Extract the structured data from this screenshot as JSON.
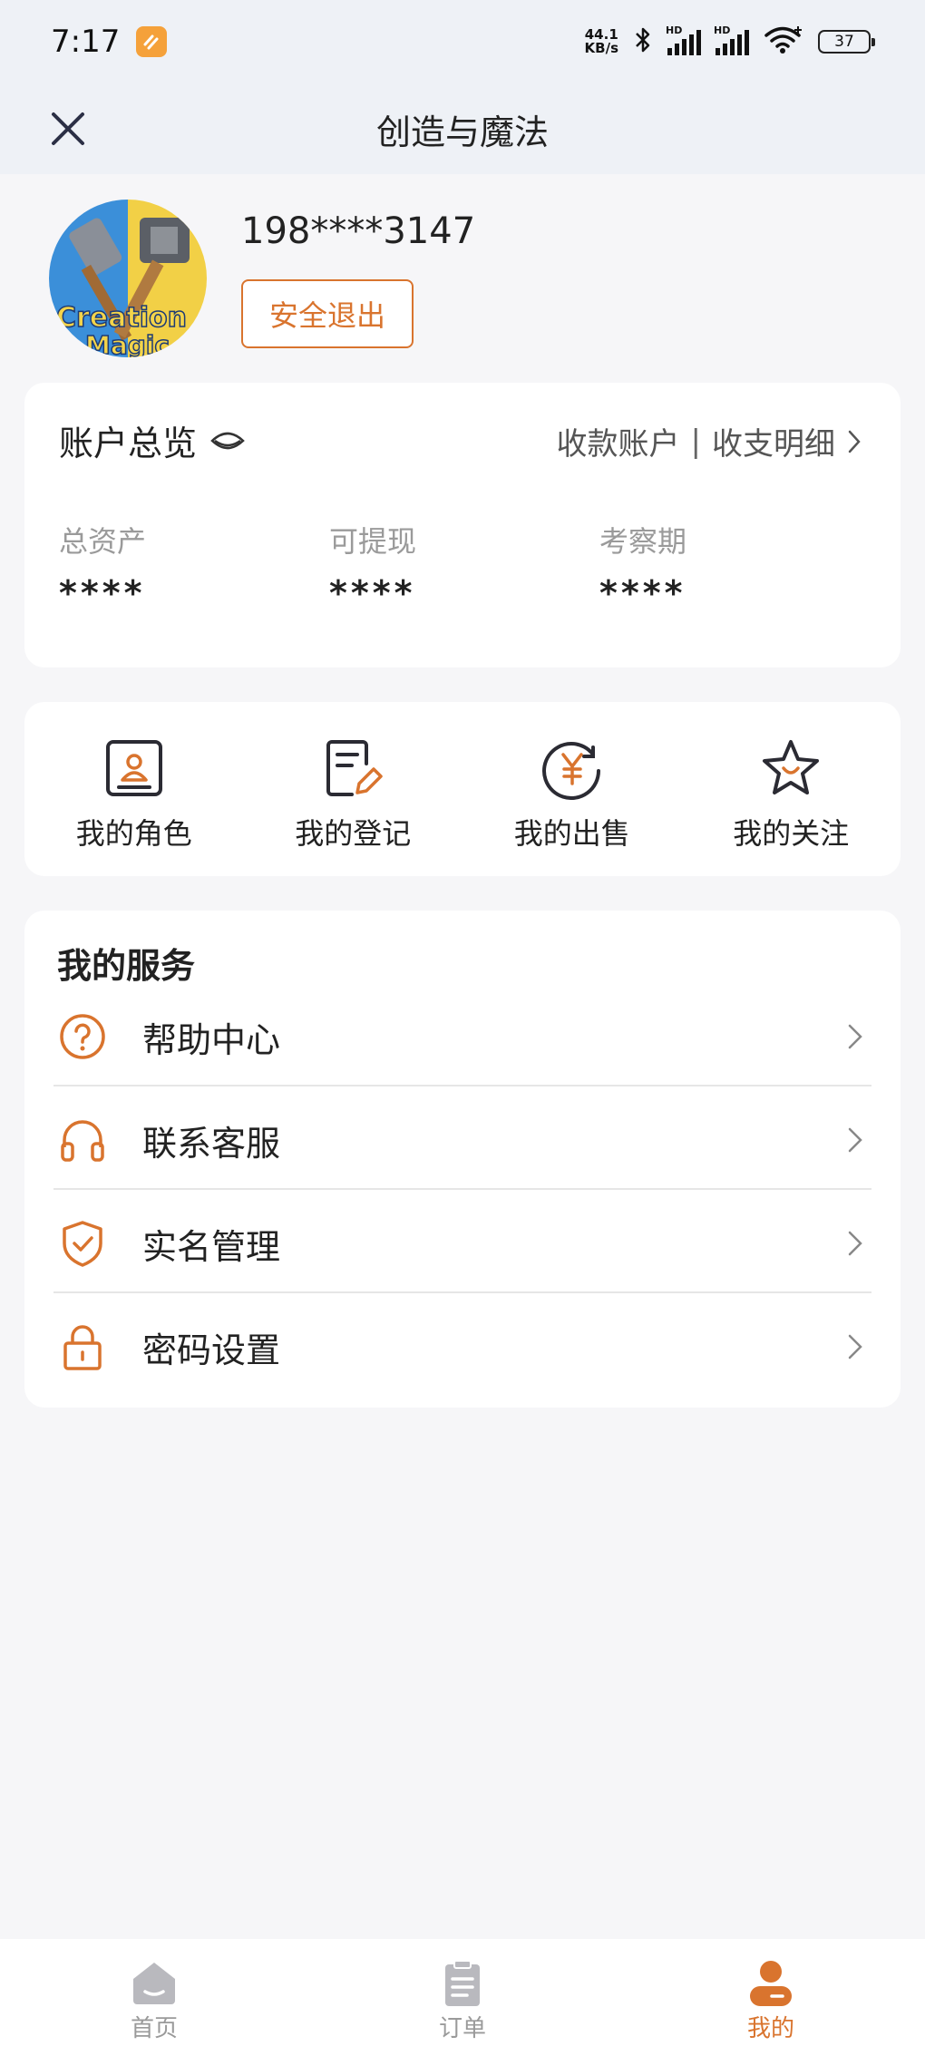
{
  "status_bar": {
    "time": "7:17",
    "net_speed_value": "44.1",
    "net_speed_unit": "KB/s",
    "hd_label": "HD",
    "battery": "37"
  },
  "header": {
    "title": "创造与魔法"
  },
  "profile": {
    "avatar_text_line1": "Creation",
    "avatar_text_line2": "Magic",
    "phone": "198****3147",
    "logout_label": "安全退出"
  },
  "account": {
    "title": "账户总览",
    "link_receiving": "收款账户",
    "link_separator": "|",
    "link_details": "收支明细",
    "stats": [
      {
        "label": "总资产",
        "value": "****"
      },
      {
        "label": "可提现",
        "value": "****"
      },
      {
        "label": "考察期",
        "value": "****"
      }
    ]
  },
  "shortcuts": [
    {
      "label": "我的角色",
      "icon": "id-card-icon"
    },
    {
      "label": "我的登记",
      "icon": "edit-note-icon"
    },
    {
      "label": "我的出售",
      "icon": "yen-coin-icon"
    },
    {
      "label": "我的关注",
      "icon": "star-icon"
    }
  ],
  "services": {
    "heading": "我的服务",
    "items": [
      {
        "label": "帮助中心",
        "icon": "help-icon"
      },
      {
        "label": "联系客服",
        "icon": "headset-icon"
      },
      {
        "label": "实名管理",
        "icon": "shield-check-icon"
      },
      {
        "label": "密码设置",
        "icon": "lock-icon"
      }
    ]
  },
  "bottom_nav": [
    {
      "label": "首页",
      "icon": "home-icon"
    },
    {
      "label": "订单",
      "icon": "orders-icon"
    },
    {
      "label": "我的",
      "icon": "profile-icon",
      "active": true
    }
  ],
  "colors": {
    "accent": "#d9742e",
    "inactive": "#9a9a9a",
    "background": "#f6f6f8",
    "header_bg": "#eef1f6"
  }
}
